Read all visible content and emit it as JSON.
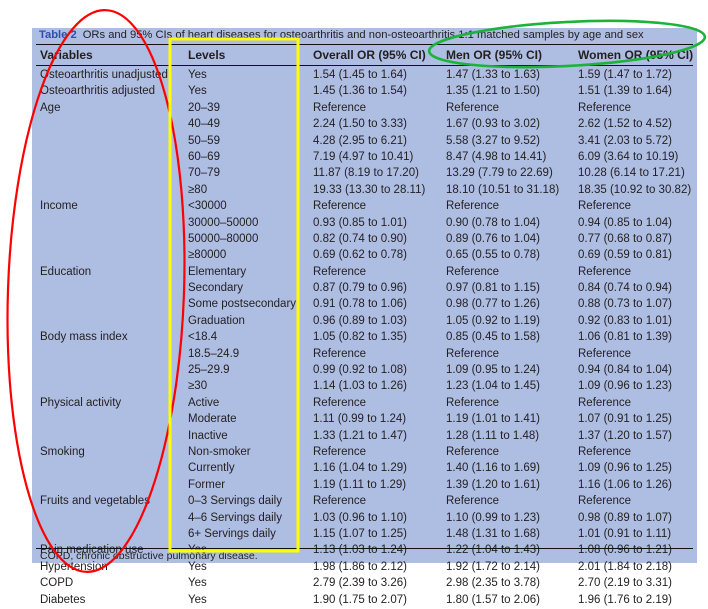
{
  "caption": {
    "label": "Table 2",
    "text": "ORs and 95% CIs of heart diseases for osteoarthritis and non-osteoarthritis 1:1 matched samples by age and sex"
  },
  "columns": {
    "variables": "Variables",
    "levels": "Levels",
    "overall": "Overall OR (95% CI)",
    "men": "Men OR (95% CI)",
    "women": "Women OR (95% CI)"
  },
  "rows": [
    {
      "variable": "Osteoarthritis unadjusted",
      "level": "Yes",
      "overall": "1.54 (1.45 to 1.64)",
      "men": "1.47 (1.33 to 1.63)",
      "women": "1.59 (1.47 to 1.72)"
    },
    {
      "variable": "Osteoarthritis adjusted",
      "level": "Yes",
      "overall": "1.45 (1.36 to 1.54)",
      "men": "1.35 (1.21 to 1.50)",
      "women": "1.51 (1.39 to 1.64)"
    },
    {
      "variable": "Age",
      "level": "20–39",
      "overall": "Reference",
      "men": "Reference",
      "women": "Reference"
    },
    {
      "variable": "",
      "level": "40–49",
      "overall": "2.24 (1.50 to 3.33)",
      "men": "1.67 (0.93 to 3.02)",
      "women": "2.62 (1.52 to 4.52)"
    },
    {
      "variable": "",
      "level": "50–59",
      "overall": "4.28 (2.95 to 6.21)",
      "men": "5.58 (3.27 to 9.52)",
      "women": "3.41 (2.03 to 5.72)"
    },
    {
      "variable": "",
      "level": "60–69",
      "overall": "7.19 (4.97 to 10.41)",
      "men": "8.47 (4.98 to 14.41)",
      "women": "6.09 (3.64 to 10.19)"
    },
    {
      "variable": "",
      "level": "70–79",
      "overall": "11.87 (8.19 to 17.20)",
      "men": "13.29 (7.79 to 22.69)",
      "women": "10.28 (6.14 to 17.21)"
    },
    {
      "variable": "",
      "level": "≥80",
      "overall": "19.33 (13.30 to 28.11)",
      "men": "18.10 (10.51 to 31.18)",
      "women": "18.35 (10.92 to 30.82)"
    },
    {
      "variable": "Income",
      "level": "<30000",
      "overall": "Reference",
      "men": "Reference",
      "women": "Reference"
    },
    {
      "variable": "",
      "level": "30000–50000",
      "overall": "0.93 (0.85 to 1.01)",
      "men": "0.90 (0.78 to 1.04)",
      "women": "0.94 (0.85 to 1.04)"
    },
    {
      "variable": "",
      "level": "50000–80000",
      "overall": "0.82 (0.74 to 0.90)",
      "men": "0.89 (0.76 to 1.04)",
      "women": "0.77 (0.68 to 0.87)"
    },
    {
      "variable": "",
      "level": "≥80000",
      "overall": "0.69 (0.62 to 0.78)",
      "men": "0.65 (0.55 to 0.78)",
      "women": "0.69 (0.59 to 0.81)"
    },
    {
      "variable": "Education",
      "level": "Elementary",
      "overall": "Reference",
      "men": "Reference",
      "women": "Reference"
    },
    {
      "variable": "",
      "level": "Secondary",
      "overall": "0.87 (0.79 to 0.96)",
      "men": "0.97 (0.81 to 1.15)",
      "women": "0.84 (0.74 to 0.94)"
    },
    {
      "variable": "",
      "level": "Some postsecondary",
      "overall": "0.91 (0.78 to 1.06)",
      "men": "0.98 (0.77 to 1.26)",
      "women": "0.88 (0.73 to 1.07)"
    },
    {
      "variable": "",
      "level": "Graduation",
      "overall": "0.96 (0.89 to 1.03)",
      "men": "1.05 (0.92 to 1.19)",
      "women": "0.92 (0.83 to 1.01)"
    },
    {
      "variable": "Body mass index",
      "level": "<18.4",
      "overall": "1.05 (0.82 to 1.35)",
      "men": "0.85 (0.45 to 1.58)",
      "women": "1.06 (0.81 to 1.39)"
    },
    {
      "variable": "",
      "level": "18.5–24.9",
      "overall": "Reference",
      "men": "Reference",
      "women": "Reference"
    },
    {
      "variable": "",
      "level": "25–29.9",
      "overall": "0.99 (0.92 to 1.08)",
      "men": "1.09 (0.95 to 1.24)",
      "women": "0.94 (0.84 to 1.04)"
    },
    {
      "variable": "",
      "level": "≥30",
      "overall": "1.14 (1.03 to 1.26)",
      "men": "1.23 (1.04 to 1.45)",
      "women": "1.09 (0.96 to 1.23)"
    },
    {
      "variable": "Physical activity",
      "level": "Active",
      "overall": "Reference",
      "men": "Reference",
      "women": "Reference"
    },
    {
      "variable": "",
      "level": "Moderate",
      "overall": "1.11 (0.99 to 1.24)",
      "men": "1.19 (1.01 to 1.41)",
      "women": "1.07 (0.91 to 1.25)"
    },
    {
      "variable": "",
      "level": "Inactive",
      "overall": "1.33 (1.21 to 1.47)",
      "men": "1.28 (1.11 to 1.48)",
      "women": "1.37 (1.20 to 1.57)"
    },
    {
      "variable": "Smoking",
      "level": "Non-smoker",
      "overall": "Reference",
      "men": "Reference",
      "women": "Reference"
    },
    {
      "variable": "",
      "level": "Currently",
      "overall": "1.16 (1.04 to 1.29)",
      "men": "1.40 (1.16 to 1.69)",
      "women": "1.09 (0.96 to 1.25)"
    },
    {
      "variable": "",
      "level": "Former",
      "overall": "1.19 (1.11 to 1.29)",
      "men": "1.39 (1.20 to 1.61)",
      "women": "1.16 (1.06 to 1.26)"
    },
    {
      "variable": "Fruits and vegetables",
      "level": "0–3 Servings daily",
      "overall": "Reference",
      "men": "Reference",
      "women": "Reference"
    },
    {
      "variable": "",
      "level": "4–6 Servings daily",
      "overall": "1.03 (0.96 to 1.10)",
      "men": "1.10 (0.99 to 1.23)",
      "women": "0.98 (0.89 to 1.07)"
    },
    {
      "variable": "",
      "level": "6+ Servings daily",
      "overall": "1.15 (1.07 to 1.25)",
      "men": "1.48 (1.31 to 1.68)",
      "women": "1.01 (0.91 to 1.11)"
    },
    {
      "variable": "Pain medication use",
      "level": "Yes",
      "overall": "1.13 (1.03 to 1.24)",
      "men": "1.22 (1.04 to 1.43)",
      "women": "1.08 (0.96 to 1.21)"
    },
    {
      "variable": "Hypertension",
      "level": "Yes",
      "overall": "1.98 (1.86 to 2.12)",
      "men": "1.92 (1.72 to 2.14)",
      "women": "2.01 (1.84 to 2.18)"
    },
    {
      "variable": "COPD",
      "level": "Yes",
      "overall": "2.79 (2.39 to 3.26)",
      "men": "2.98 (2.35 to 3.78)",
      "women": "2.70 (2.19 to 3.31)"
    },
    {
      "variable": "Diabetes",
      "level": "Yes",
      "overall": "1.90 (1.75 to 2.07)",
      "men": "1.80 (1.57 to 2.06)",
      "women": "1.96 (1.76 to 2.19)"
    }
  ],
  "footnote": "COPD, chronic obstructive pulmonary disease.",
  "annotations": {
    "variables_highlight_color": "#ff0000",
    "levels_highlight_color": "#ffff00",
    "sex_columns_highlight_color": "#1db33a"
  },
  "colors": {
    "table_background": "#aebde2",
    "caption_label": "#2f4fa8",
    "text": "#231f20"
  }
}
